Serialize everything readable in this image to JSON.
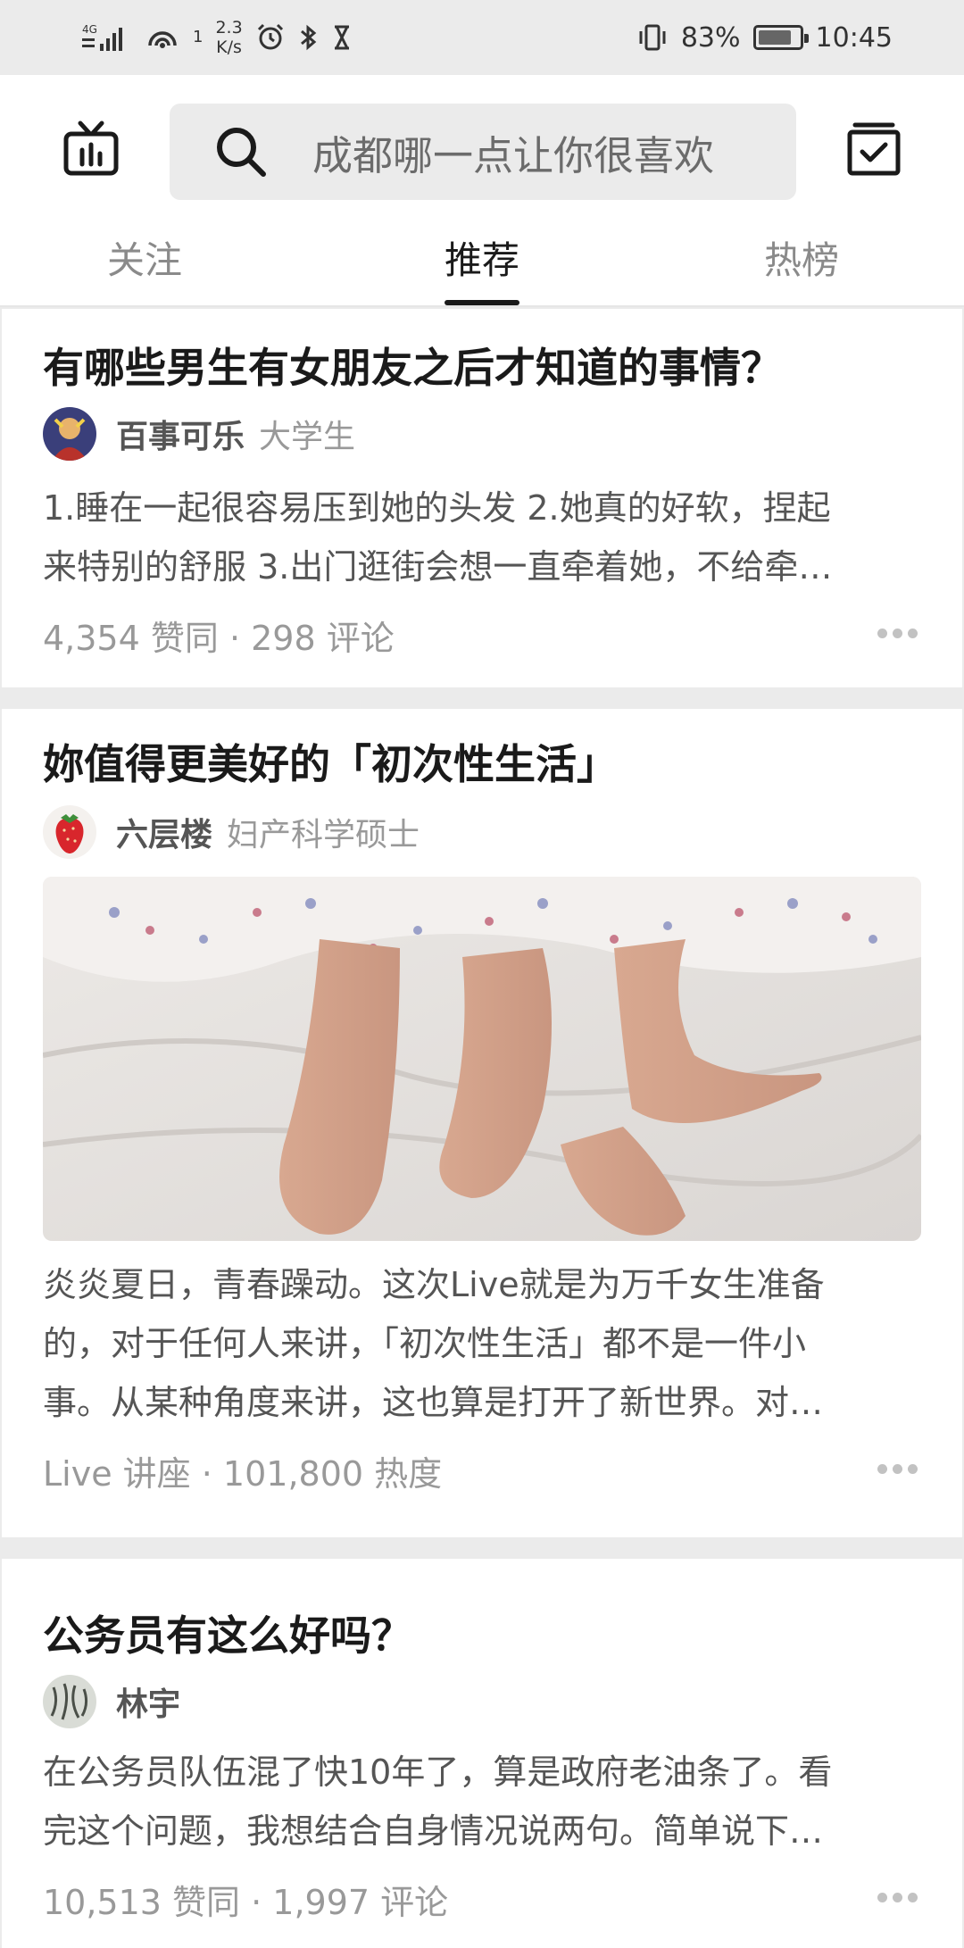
{
  "status_bar": {
    "signal": "4G",
    "sim": "1",
    "speed_value": "2.3",
    "speed_unit": "K/s",
    "battery_percent": "83%",
    "battery_level": 0.83,
    "time": "10:45"
  },
  "header": {
    "search_placeholder": "成都哪一点让你很喜欢",
    "tabs": [
      {
        "label": "关注"
      },
      {
        "label": "推荐"
      },
      {
        "label": "热榜"
      }
    ],
    "active_tab": "推荐"
  },
  "feed": [
    {
      "title": "有哪些男生有女朋友之后才知道的事情？",
      "author_name": "百事可乐",
      "author_desc": "大学生",
      "excerpt_lines": [
        "1.睡在一起很容易压到她的头发 2.她真的好软，捏起",
        "来特别的舒服 3.出门逛街会想一直牵着她，不给牵…"
      ],
      "meta": "4,354 赞同 · 298 评论"
    },
    {
      "title": "妳值得更美好的「初次性生活」",
      "author_name": "六层楼",
      "author_desc": "妇产科学硕士",
      "excerpt_lines": [
        "炎炎夏日，青春躁动。这次Live就是为万千女生准备",
        "的，对于任何人来讲，「初次性生活」都不是一件小",
        "事。从某种角度来讲，这也算是打开了新世界。对…"
      ],
      "meta": "Live 讲座 · 101,800 热度"
    },
    {
      "title": "公务员有这么好吗？",
      "author_name": "林宇",
      "author_desc": "",
      "excerpt_lines": [
        "在公务员队伍混了快10年了，算是政府老油条了。看",
        "完这个问题，我想结合自身情况说两句。简单说下…"
      ],
      "meta": "10,513 赞同 · 1,997 评论"
    }
  ],
  "icons": {
    "tv": "tv-icon",
    "search": "search-icon",
    "tasks": "checklist-icon",
    "more": "more-icon"
  }
}
